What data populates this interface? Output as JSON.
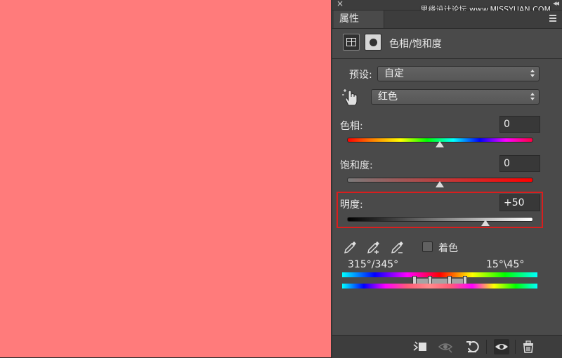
{
  "watermark": "思缘设计论坛 www.MISSYUAN.COM",
  "panel": {
    "tab_label": "属性",
    "adjustment_title": "色相/饱和度"
  },
  "preset": {
    "label": "预设:",
    "value": "自定"
  },
  "channel": {
    "value": "红色"
  },
  "hue": {
    "label": "色相:",
    "value": "0",
    "position": 0.5
  },
  "saturation": {
    "label": "饱和度:",
    "value": "0",
    "position": 0.5
  },
  "lightness": {
    "label": "明度:",
    "value": "+50",
    "position": 0.75
  },
  "colorize": {
    "label": "着色",
    "checked": false
  },
  "range": {
    "left_label": "315°/345°",
    "right_label": "15°\\45°"
  },
  "colors": {
    "canvas": "#ff7b7b",
    "panel_bg": "#4a4a4a",
    "highlight": "#d81e1e"
  },
  "icons": {
    "close": "close-icon",
    "collapse": "collapse-icon",
    "menu": "panel-menu-icon",
    "adjustment": "hue-saturation-icon",
    "mask": "mask-icon",
    "targeted_adjust": "hand-targeted-adjust-icon",
    "eyedropper": "eyedropper-icon",
    "eyedropper_add": "eyedropper-add-icon",
    "eyedropper_subtract": "eyedropper-subtract-icon",
    "clip": "clip-to-layer-icon",
    "view_previous": "view-previous-icon",
    "reset": "reset-icon",
    "visibility": "eye-icon",
    "delete": "trash-icon"
  }
}
